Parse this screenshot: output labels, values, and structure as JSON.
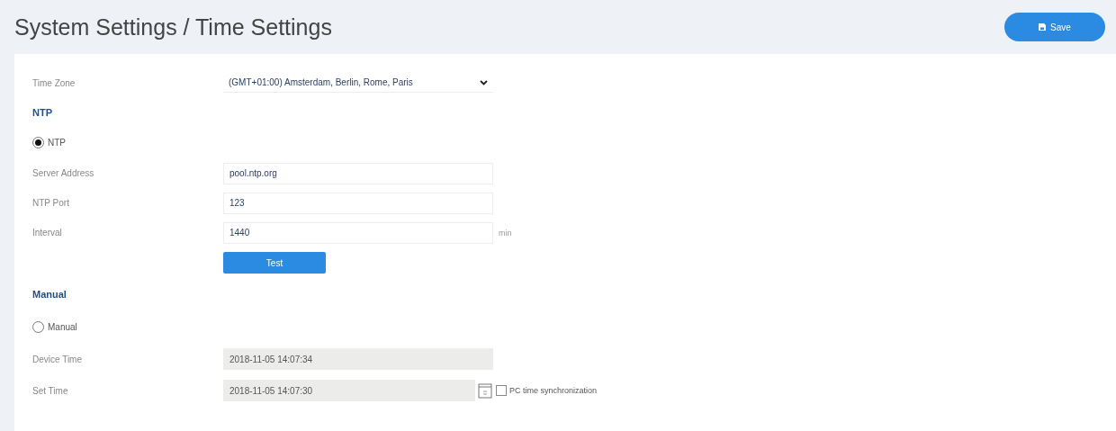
{
  "page": {
    "title": "System Settings / Time Settings",
    "save_button": "Save"
  },
  "time_zone": {
    "label": "Time Zone",
    "value": "(GMT+01:00) Amsterdam, Berlin, Rome, Paris"
  },
  "ntp": {
    "heading": "NTP",
    "radio": {
      "label": "NTP",
      "selected": true
    },
    "fields": [
      {
        "label": "Server Address",
        "value": "pool.ntp.org"
      },
      {
        "label": "NTP Port",
        "value": "123"
      },
      {
        "label": "Interval",
        "value": "1440",
        "unit": "min"
      }
    ],
    "test_button": "Test"
  },
  "manual": {
    "heading": "Manual",
    "radio": {
      "label": "Manual",
      "selected": false
    },
    "device_time": {
      "label": "Device Time",
      "value": "2018-11-05 14:07:34"
    },
    "set_time": {
      "label": "Set Time",
      "value": "2018-11-05 14:07:30"
    },
    "pc_sync": {
      "label": "PC time synchronization",
      "checked": false
    }
  }
}
